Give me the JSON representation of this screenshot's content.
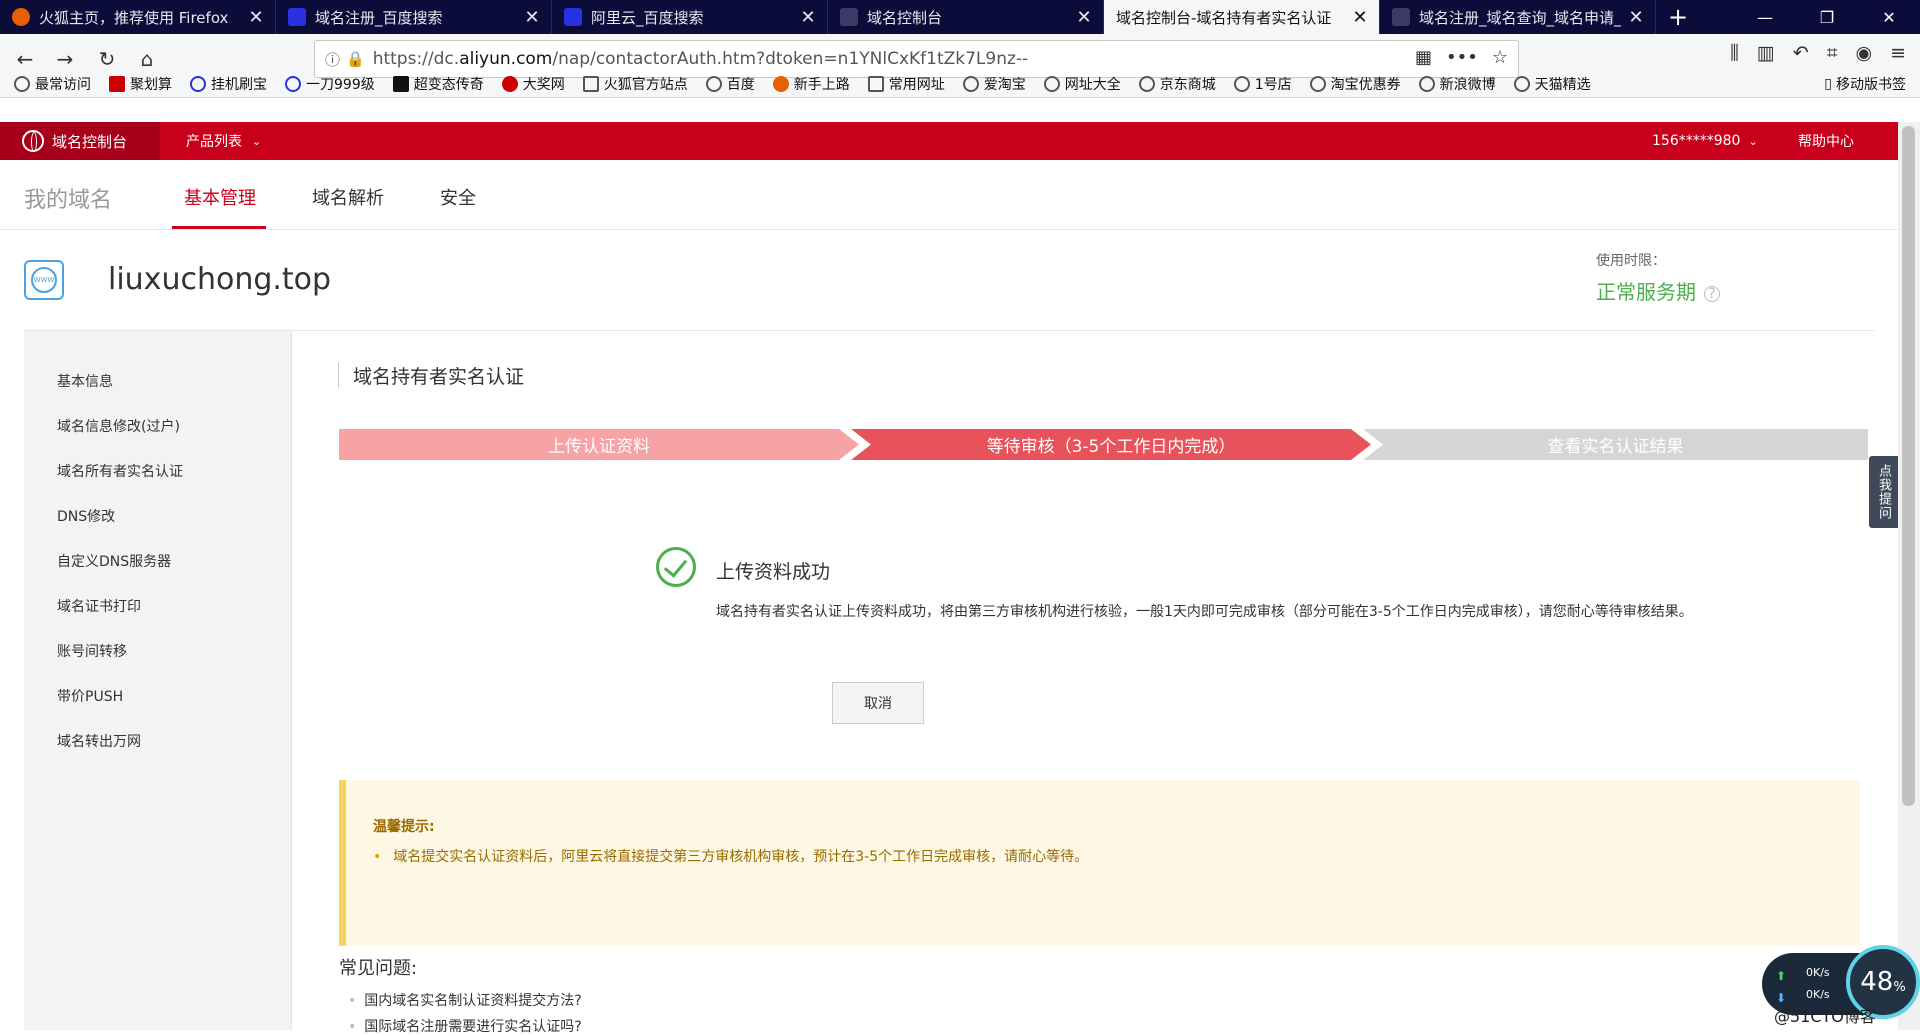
{
  "browser": {
    "tabs": [
      {
        "title": "火狐主页，推荐使用 Firefox",
        "favicon_color": "#e66000"
      },
      {
        "title": "域名注册_百度搜索",
        "favicon_color": "#2932e1"
      },
      {
        "title": "阿里云_百度搜索",
        "favicon_color": "#2932e1"
      },
      {
        "title": "域名控制台",
        "favicon_color": "#3b3b66"
      },
      {
        "title": "域名控制台-域名持有者实名认证",
        "favicon_color": "#3b3b66"
      },
      {
        "title": "域名注册_域名查询_域名申请_",
        "favicon_color": "#3b3b66"
      }
    ],
    "new_tab": "+",
    "url_prefix": "https://dc.",
    "url_domain": "aliyun.com",
    "url_rest": "/nap/contactorAuth.htm?dtoken=n1YNlCxKf1tZk7L9nz--",
    "bookmarks": [
      "最常访问",
      "聚划算",
      "挂机刷宝",
      "一刀999级",
      "超变态传奇",
      "大奖网",
      "火狐官方站点",
      "百度",
      "新手上路",
      "常用网址",
      "爱淘宝",
      "网址大全",
      "京东商城",
      "1号店",
      "淘宝优惠券",
      "新浪微博",
      "天猫精选"
    ],
    "mobile_bookmarks": "移动版书签"
  },
  "header": {
    "brand": "域名控制台",
    "products": "产品列表",
    "user": "156*****980",
    "help": "帮助中心"
  },
  "subnav": {
    "my_domains": "我的域名",
    "tabs": [
      "基本管理",
      "域名解析",
      "安全"
    ]
  },
  "domain": {
    "name": "liuxuchong.top",
    "icon_text": "WWW",
    "term_label": "使用时限：",
    "term_value": "正常服务期"
  },
  "sidebar": {
    "items": [
      "基本信息",
      "域名信息修改(过户)",
      "域名所有者实名认证",
      "DNS修改",
      "自定义DNS服务器",
      "域名证书打印",
      "账号间转移",
      "带价PUSH",
      "域名转出万网"
    ]
  },
  "main": {
    "section_title": "域名持有者实名认证",
    "steps": [
      "上传认证资料",
      "等待审核（3-5个工作日内完成）",
      "查看实名认证结果"
    ],
    "success_title": "上传资料成功",
    "success_desc": "域名持有者实名认证上传资料成功，将由第三方审核机构进行核验，一般1天内即可完成审核（部分可能在3-5个工作日内完成审核），请您耐心等待审核结果。",
    "cancel_label": "取消",
    "tip_title": "温馨提示:",
    "tip_item": "域名提交实名认证资料后，阿里云将直接提交第三方审核机构审核，预计在3-5个工作日完成审核，请耐心等待。",
    "faq_title": "常见问题:",
    "faq_items": [
      "国内域名实名制认证资料提交方法?",
      "国际域名注册需要进行实名认证吗?"
    ]
  },
  "floating": {
    "side_help": "点我提问",
    "net_up": "0K/s",
    "net_down": "0K/s",
    "percent": "48",
    "percent_unit": "%",
    "watermark": "@51CTO博客"
  },
  "colors": {
    "brand_red": "#c9001b",
    "step_done": "#f5a3a5",
    "step_current": "#e8525a",
    "step_pending": "#d5d5d5",
    "success_green": "#4cae4c"
  }
}
